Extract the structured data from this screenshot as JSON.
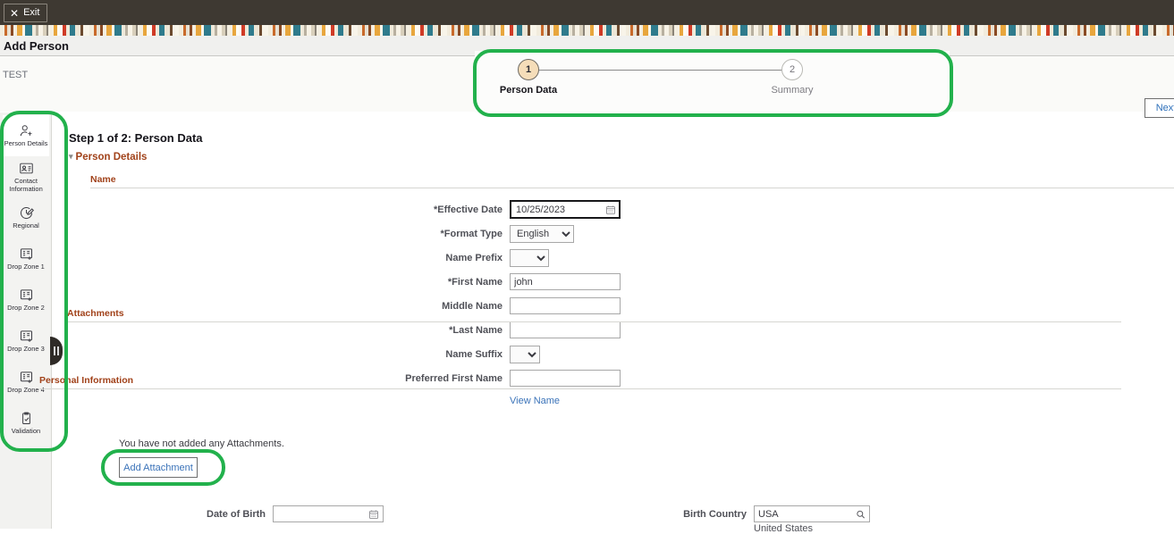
{
  "topbar": {
    "exit_label": "Exit",
    "exit_icon": "close-x-icon"
  },
  "titlebar": {
    "title": "Add Person"
  },
  "subheader": {
    "context_label": "TEST"
  },
  "stepper": {
    "steps": [
      {
        "number": "1",
        "label": "Person Data",
        "state": "active"
      },
      {
        "number": "2",
        "label": "Summary",
        "state": "inactive"
      }
    ],
    "active_color": "#f5ddb9"
  },
  "actions": {
    "next_label": "Next"
  },
  "sidebar": {
    "items": [
      {
        "label": "Person Details",
        "icon": "person-add-icon",
        "active": true
      },
      {
        "label": "Contact Information",
        "icon": "contact-card-icon",
        "active": false
      },
      {
        "label": "Regional",
        "icon": "clock-edit-icon",
        "active": false
      },
      {
        "label": "Drop Zone 1",
        "icon": "list-add-icon",
        "active": false
      },
      {
        "label": "Drop Zone 2",
        "icon": "list-add-icon",
        "active": false
      },
      {
        "label": "Drop Zone 3",
        "icon": "list-add-icon",
        "active": false
      },
      {
        "label": "Drop Zone 4",
        "icon": "list-add-icon",
        "active": false
      },
      {
        "label": "Validation",
        "icon": "clipboard-check-icon",
        "active": false
      }
    ],
    "collapse_handle_icon": "pause-bars-icon"
  },
  "main": {
    "step_heading": "Step 1 of 2: Person Data",
    "section_person_details": "Person Details",
    "section_chevron": "chevron-down-icon",
    "subsection_name": "Name",
    "subsection_attachments": "Attachments",
    "subsection_personal": "Personal Information",
    "fields": [
      {
        "label": "*Effective Date",
        "type": "date",
        "value": "10/25/2023",
        "placeholder": "",
        "icon": "calendar-icon",
        "focused": true,
        "name": "effective-date-field"
      },
      {
        "label": "*Format Type",
        "type": "select",
        "value": "English",
        "options": [
          "English"
        ],
        "width": "w-fmt",
        "name": "format-type-select"
      },
      {
        "label": "Name Prefix",
        "type": "select",
        "value": "",
        "options": [
          ""
        ],
        "width": "w-prefix",
        "name": "name-prefix-select"
      },
      {
        "label": "*First Name",
        "type": "text",
        "value": "john",
        "placeholder": "",
        "name": "first-name-field"
      },
      {
        "label": "Middle Name",
        "type": "text",
        "value": "",
        "placeholder": "",
        "name": "middle-name-field"
      },
      {
        "label": "*Last Name",
        "type": "text",
        "value": "",
        "placeholder": "",
        "name": "last-name-field"
      },
      {
        "label": "Name Suffix",
        "type": "select",
        "value": "",
        "options": [
          ""
        ],
        "width": "w-suffix",
        "name": "name-suffix-select"
      },
      {
        "label": "Preferred First Name",
        "type": "text",
        "value": "",
        "placeholder": "",
        "name": "preferred-first-name-field"
      }
    ],
    "view_name_link": "View Name",
    "attachments_message": "You have not added any Attachments.",
    "add_attachment_label": "Add Attachment",
    "personal": {
      "dob_label": "Date of Birth",
      "dob_value": "",
      "dob_icon": "calendar-icon",
      "country_label": "Birth Country",
      "country_value": "USA",
      "country_icon": "search-lookup-icon",
      "country_description": "United States"
    }
  },
  "highlights": {
    "color": "#22b14c",
    "regions": [
      "stepper",
      "sidebar",
      "add-attachment-button"
    ]
  }
}
